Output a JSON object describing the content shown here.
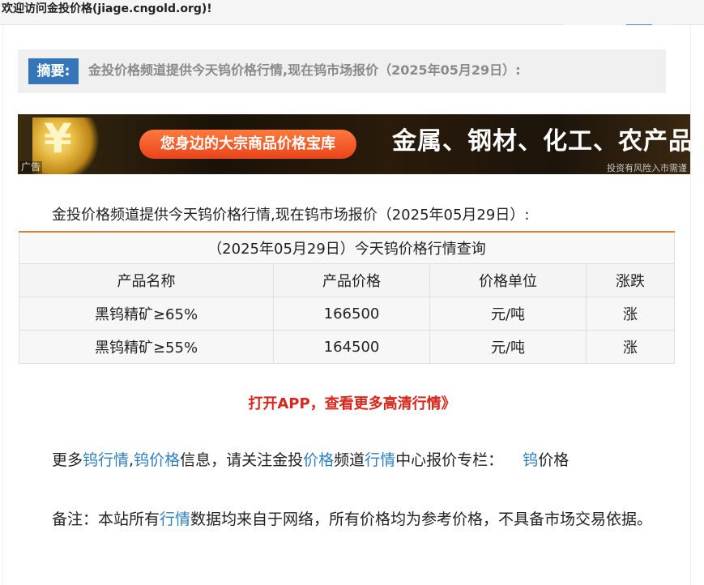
{
  "header": {
    "welcome": "欢迎访问金投价格(jiage.cngold.org)!"
  },
  "summary": {
    "tag": "摘要:",
    "text": "金投价格频道提供今天钨价格行情,现在钨市场报价（2025年05月29日）:"
  },
  "ad": {
    "icon": "yen-coins-icon",
    "pill_text": "您身边的大宗商品价格宝库",
    "headline": "金属、钢材、化工、农产品",
    "label": "广告",
    "disclaimer": "投资有风险入市需谨"
  },
  "article": {
    "intro": "金投价格频道提供今天钨价格行情,现在钨市场报价（2025年05月29日）:",
    "table": {
      "caption": "（2025年05月29日）今天钨价格行情查询",
      "columns": [
        "产品名称",
        "产品价格",
        "价格单位",
        "涨跌"
      ],
      "rows": [
        [
          "黑钨精矿≥65%",
          "166500",
          "元/吨",
          "涨"
        ],
        [
          "黑钨精矿≥55%",
          "164500",
          "元/吨",
          "涨"
        ]
      ]
    },
    "app_link": "打开APP，查看更多高清行情》",
    "more": {
      "t1": "更多",
      "l1": "钨行情",
      "t2": ",",
      "l2": "钨价格",
      "t3": "信息，请关注金投",
      "l3": "价格",
      "t4": "频道",
      "l4": "行情",
      "t5": "中心报价专栏：",
      "l5": "钨",
      "t6": "价格"
    },
    "note": {
      "t1": "备注：本站所有",
      "l1": "行情",
      "t2": "数据均来自于网络，所有价格均为参考价格，不具备市场交易依据。"
    }
  },
  "colors": {
    "tag_blue": "#3576b8",
    "link_blue": "#2f7fc1",
    "app_red": "#d9261c",
    "table_accent": "#e07a3c"
  }
}
